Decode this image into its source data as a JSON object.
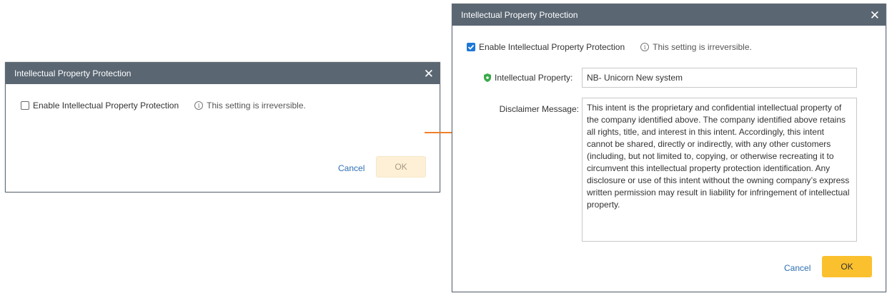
{
  "left_dialog": {
    "title": "Intellectual Property Protection",
    "checkbox_label": "Enable Intellectual Property Protection",
    "checkbox_checked": false,
    "hint": "This setting is irreversible.",
    "cancel_label": "Cancel",
    "ok_label": "OK",
    "ok_enabled": false
  },
  "right_dialog": {
    "title": "Intellectual Property Protection",
    "checkbox_label": "Enable Intellectual Property Protection",
    "checkbox_checked": true,
    "hint": "This setting is irreversible.",
    "ip_label": "Intellectual Property:",
    "ip_value": "NB- Unicorn New system",
    "disclaimer_label": "Disclaimer Message:",
    "disclaimer_text": "This intent is the proprietary and confidential intellectual property of the company identified above. The company identified above retains all rights, title, and interest in this intent. Accordingly, this intent cannot be shared, directly or indirectly, with any other customers (including, but not limited to, copying, or otherwise recreating it to circumvent this intellectual property protection identification. Any disclosure or use of this intent without the owning company’s express written permission may result in liability for infringement of intellectual property.",
    "cancel_label": "Cancel",
    "ok_label": "OK",
    "ok_enabled": true
  },
  "colors": {
    "titlebar": "#5a6672",
    "accent_checkbox": "#1d77d7",
    "ok_active": "#fbc02d",
    "ok_disabled": "#fdf0d6",
    "link": "#2d6fb5",
    "arrow": "#f07f2a",
    "shield": "#3aaa4a"
  }
}
